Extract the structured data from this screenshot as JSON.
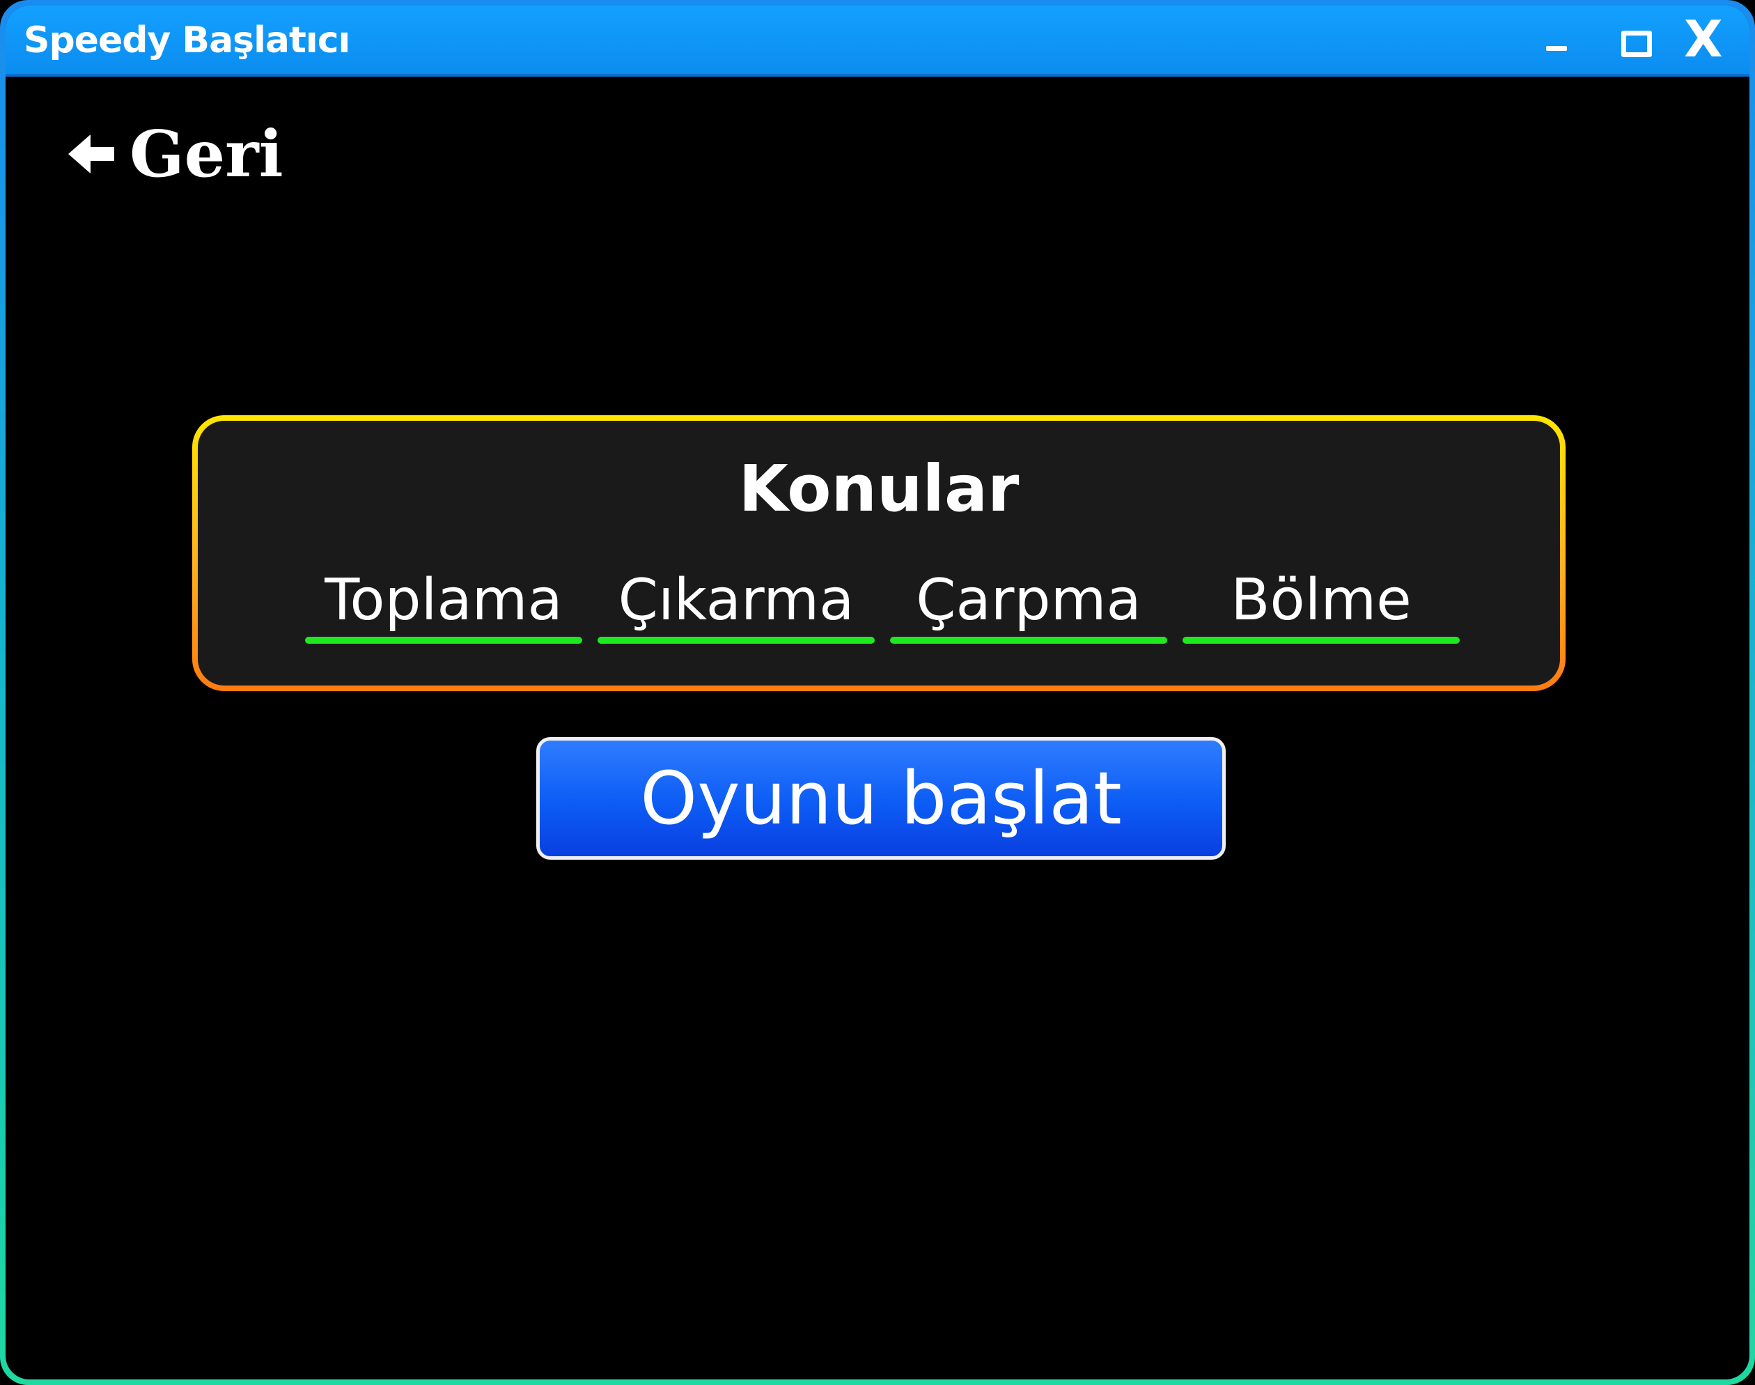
{
  "window": {
    "title": "Speedy Başlatıcı",
    "controls": {
      "minimize": "minimize",
      "maximize": "maximize",
      "close": "X"
    }
  },
  "nav": {
    "back_label": "Geri"
  },
  "topics": {
    "heading": "Konular",
    "items": [
      {
        "label": "Toplama"
      },
      {
        "label": "Çıkarma"
      },
      {
        "label": "Çarpma"
      },
      {
        "label": "Bölme"
      }
    ]
  },
  "actions": {
    "start_label": "Oyunu başlat"
  },
  "colors": {
    "titlebar": "#0b8df0",
    "panel_border_top": "#ffe600",
    "panel_border_bottom": "#ff7b10",
    "underline": "#1ee81e",
    "button": "#0c5cf5"
  }
}
